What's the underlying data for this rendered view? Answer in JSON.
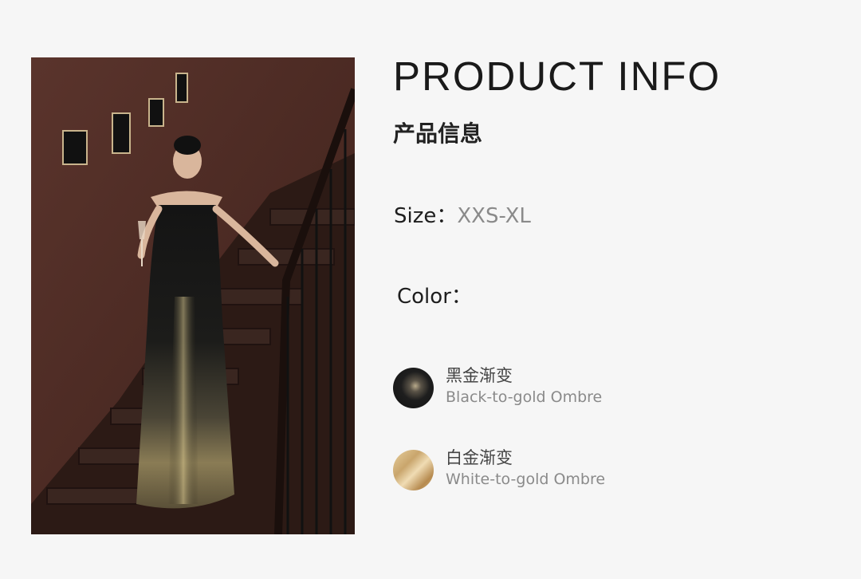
{
  "title": "PRODUCT INFO",
  "subtitle": "产品信息",
  "size": {
    "label": "Size：",
    "value": "XXS-XL"
  },
  "color": {
    "label": "Color：",
    "options": [
      {
        "name_cn": "黑金渐变",
        "name_en": "Black-to-gold Ombre",
        "swatch": "#1e1e1e"
      },
      {
        "name_cn": "白金渐变",
        "name_en": "White-to-gold Ombre",
        "swatch": "#d8bb85"
      }
    ]
  }
}
